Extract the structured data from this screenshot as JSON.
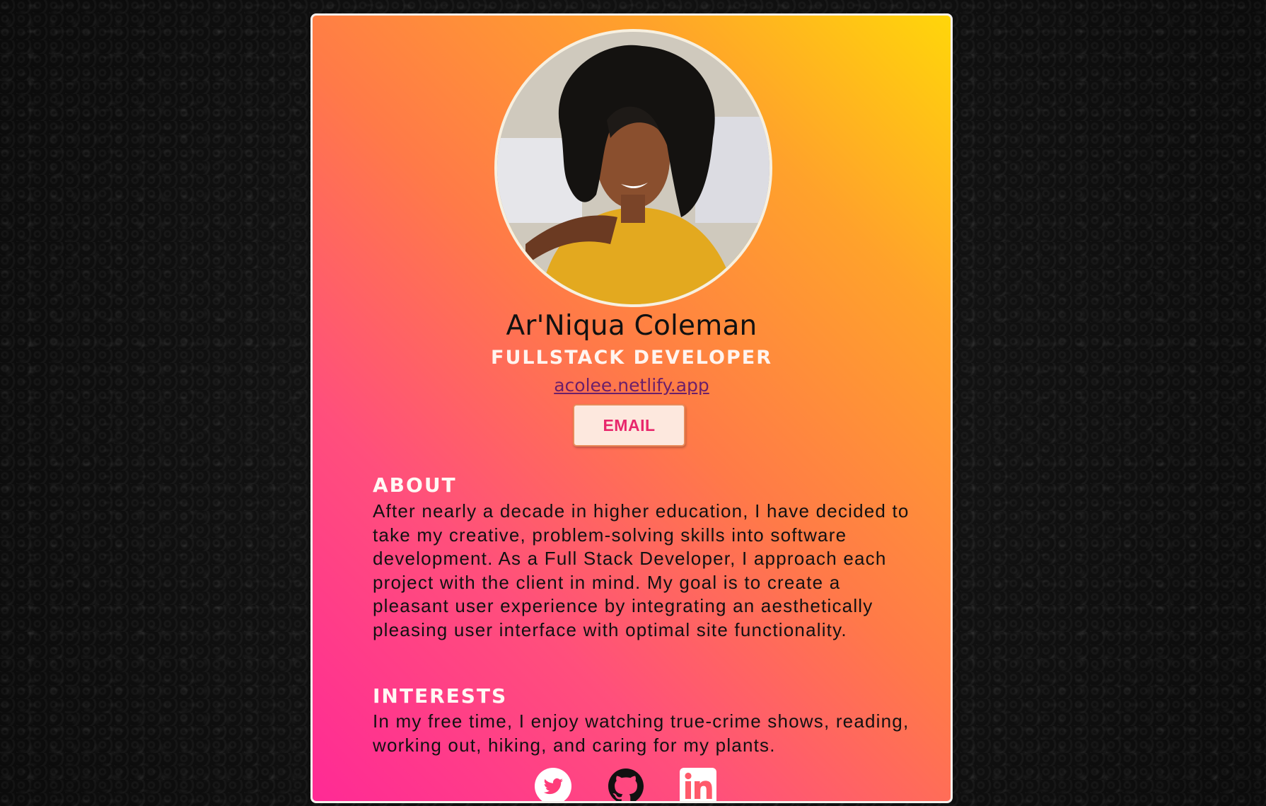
{
  "profile": {
    "name": "Ar'Niqua Coleman",
    "role": "FULLSTACK DEVELOPER",
    "website": "acolee.netlify.app",
    "email_label": "EMAIL"
  },
  "about": {
    "heading": "ABOUT",
    "text": "After nearly a decade in higher education, I have decided to take my creative, problem-solving skills into software development. As a Full Stack Developer, I approach each project with the client in mind. My goal is to create a pleasant user experience by integrating an aesthetically pleasing user interface with optimal site functionality."
  },
  "interests": {
    "heading": "INTERESTS",
    "text": "In my free time, I enjoy watching true-crime shows, reading, working out, hiking, and caring for my plants."
  },
  "socials": [
    {
      "icon": "twitter-icon"
    },
    {
      "icon": "github-icon"
    },
    {
      "icon": "linkedin-icon"
    }
  ],
  "colors": {
    "gradient_top_right": "#ffd60a",
    "gradient_mid": "#ff7a48",
    "gradient_bottom_left": "#ff2a95",
    "email_text": "#e8276c",
    "link": "#6b1f6a"
  }
}
